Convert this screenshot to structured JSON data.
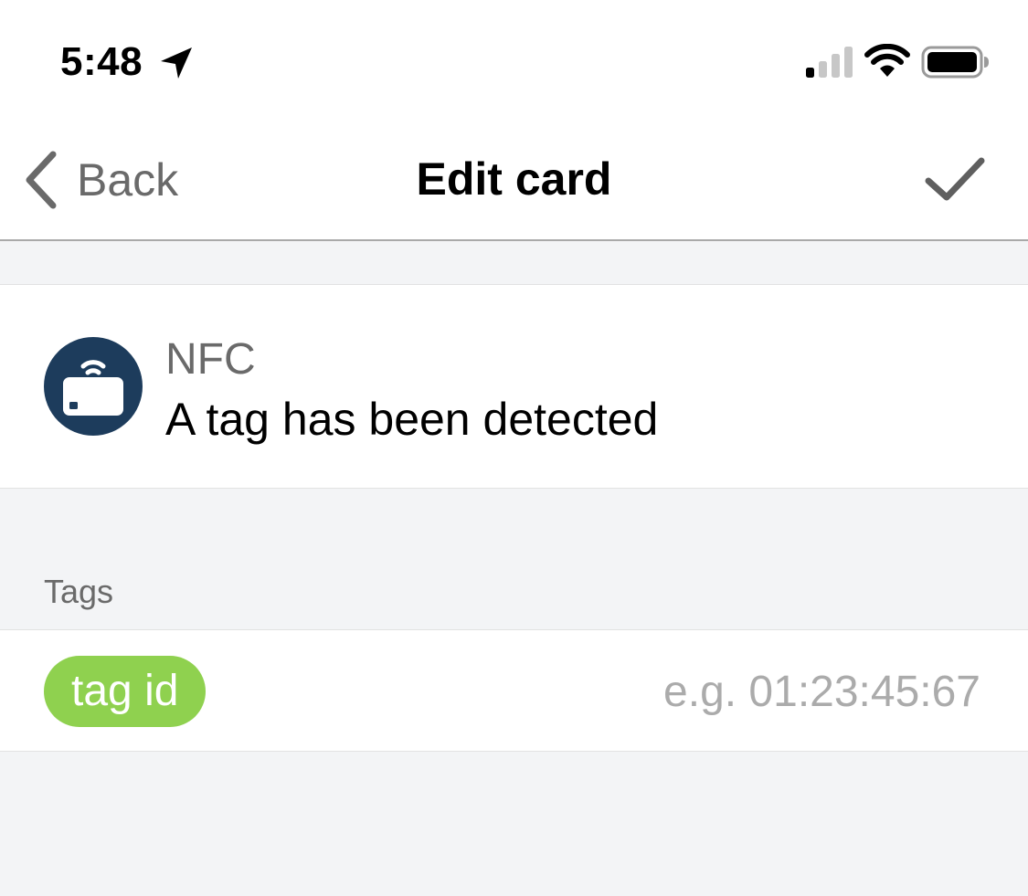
{
  "status_bar": {
    "time": "5:48",
    "icons": [
      "location-arrow-icon",
      "cellular-signal-icon",
      "wifi-icon",
      "battery-icon"
    ]
  },
  "nav": {
    "back_label": "Back",
    "title": "Edit card",
    "confirm_icon": "checkmark-icon"
  },
  "card": {
    "icon": "nfc-card-icon",
    "type": "NFC",
    "status": "A tag has been detected"
  },
  "tags_section": {
    "header": "Tags",
    "chip_label": "tag id",
    "input_value": "",
    "input_placeholder": "e.g. 01:23:45:67"
  },
  "colors": {
    "nfc_icon_bg": "#1d3c5c",
    "tag_chip_bg": "#8fd14f",
    "screen_bg": "#f3f4f6",
    "secondary_text": "#6a6a6a",
    "placeholder_text": "#ababab"
  }
}
